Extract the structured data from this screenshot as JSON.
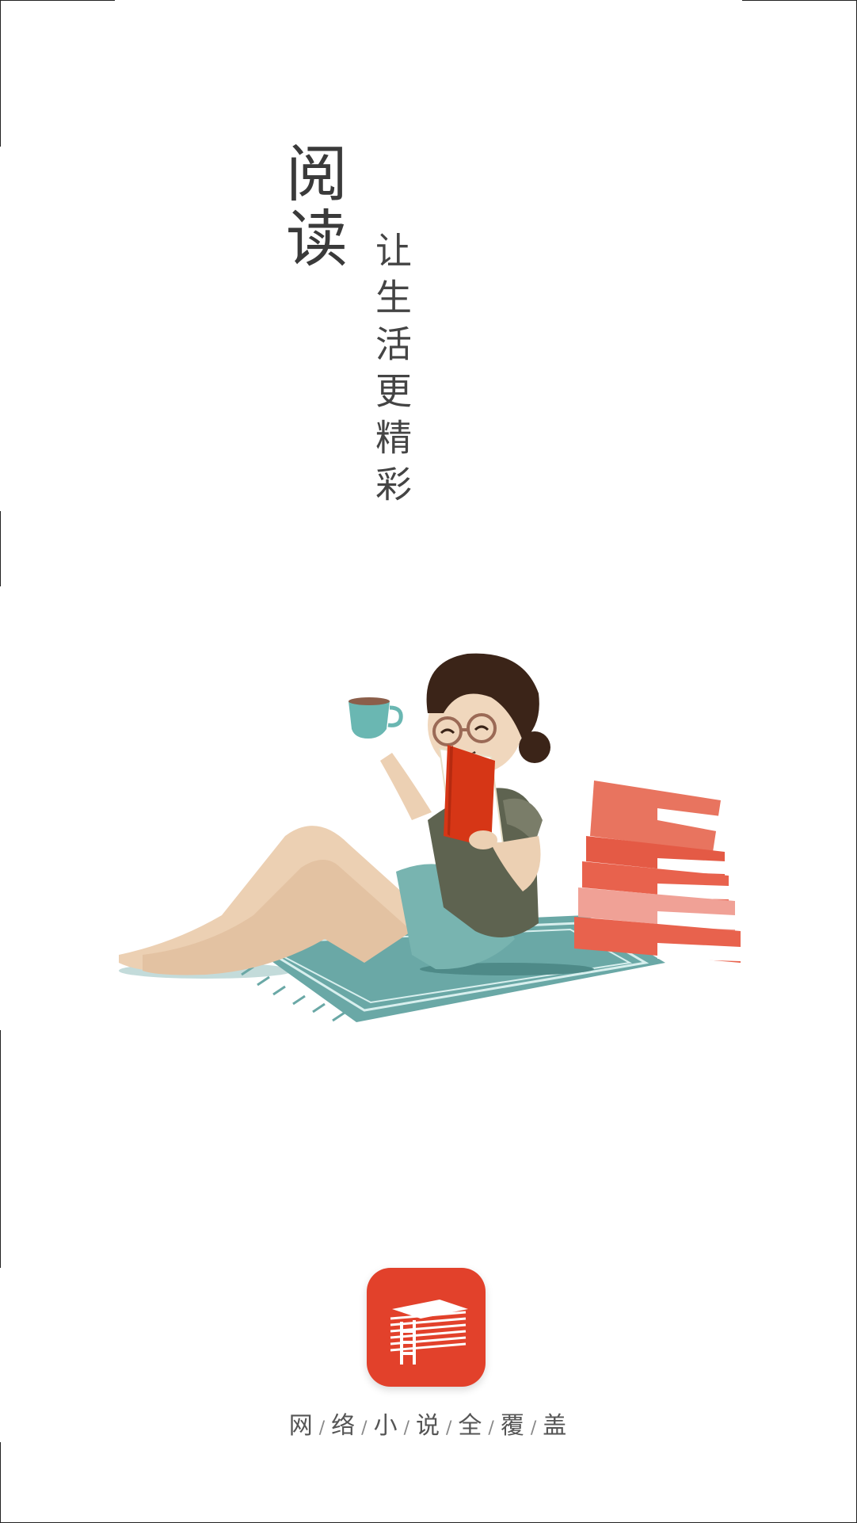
{
  "splash": {
    "headline": "阅读",
    "subline": "让生活更精彩",
    "tagline_words": [
      "网",
      "络",
      "小",
      "说",
      "全",
      "覆",
      "盖"
    ],
    "tagline_separator": "/",
    "illustration": "woman-reading-book-icon",
    "logo": "book-stack-ladder-icon"
  },
  "colors": {
    "accent": "#e2412b",
    "rug": "#6aa8a6",
    "books": "#e8624d",
    "text": "#3a3a3a"
  }
}
